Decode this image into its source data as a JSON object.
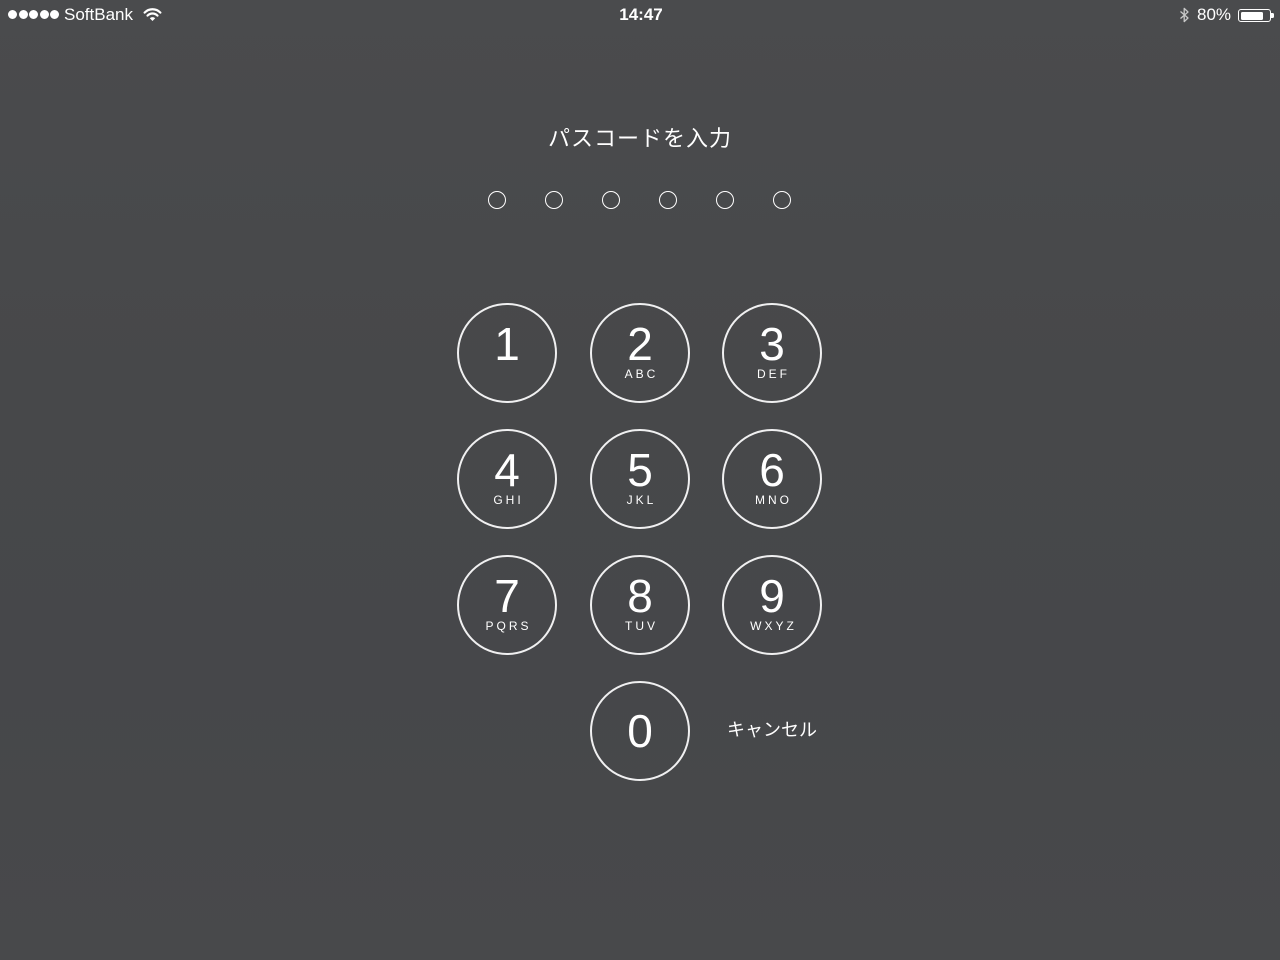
{
  "status_bar": {
    "signal_dots_filled": 5,
    "signal_dots_total": 5,
    "carrier": "SoftBank",
    "time": "14:47",
    "battery_percent_label": "80%",
    "battery_level": 0.8,
    "icons": [
      "signal-dots",
      "wifi-icon",
      "bluetooth-icon",
      "battery-icon"
    ]
  },
  "passcode": {
    "prompt": "パスコードを入力",
    "length": 6,
    "entered": 0
  },
  "keypad": {
    "keys": [
      {
        "digit": "1"
      },
      {
        "digit": "2",
        "letters": "ABC"
      },
      {
        "digit": "3",
        "letters": "DEF"
      },
      {
        "digit": "4",
        "letters": "GHI"
      },
      {
        "digit": "5",
        "letters": "JKL"
      },
      {
        "digit": "6",
        "letters": "MNO"
      },
      {
        "digit": "7",
        "letters": "PQRS"
      },
      {
        "digit": "8",
        "letters": "TUV"
      },
      {
        "digit": "9",
        "letters": "WXYZ"
      },
      {
        "digit": "0"
      }
    ],
    "cancel_label": "キャンセル"
  },
  "colors": {
    "background": "#48494b",
    "foreground": "#ffffff"
  }
}
